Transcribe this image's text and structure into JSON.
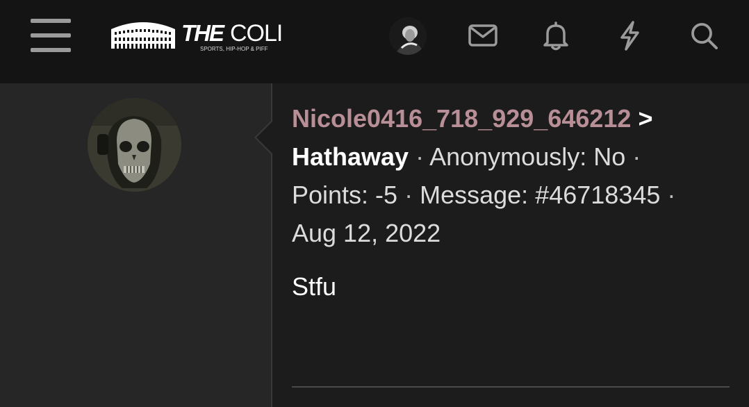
{
  "header": {
    "logo": {
      "the": "THE",
      "coli": "COLI",
      "tagline": "SPORTS, HIP-HOP & PIFF"
    },
    "icons": [
      "menu-icon",
      "avatar",
      "mail-icon",
      "bell-icon",
      "lightning-icon",
      "search-icon"
    ]
  },
  "post": {
    "username": "Nicole0416_718_929_646212",
    "arrow": ">",
    "recipient": "Hathaway",
    "separator": "·",
    "anonymously": "Anonymously: No",
    "points": "Points: -5",
    "message": "Message: #46718345",
    "date": "Aug 12, 2022",
    "body": "Stfu"
  },
  "colors": {
    "header_bg": "#141414",
    "sidebar_bg": "#262626",
    "content_bg": "#1c1c1c",
    "username": "#b88f97",
    "text": "#dcdcdc"
  }
}
